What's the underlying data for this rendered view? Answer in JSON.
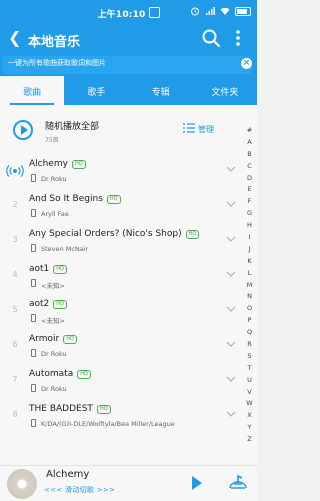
{
  "status_bar": {
    "time": "上午10:10"
  },
  "header": {
    "title": "本地音乐",
    "back_icon": "back-arrow-icon",
    "search_icon": "search-icon",
    "more_icon": "more-vertical-icon"
  },
  "banner": {
    "text": "一键为所有歌曲获取歌词和图片",
    "close_icon": "close-icon"
  },
  "tabs": [
    {
      "label": "歌曲"
    },
    {
      "label": "歌手"
    },
    {
      "label": "专辑"
    },
    {
      "label": "文件夹"
    }
  ],
  "shuffle": {
    "label": "随机播放全部",
    "count": "75首",
    "manage_label": "管理"
  },
  "songs": [
    {
      "index": "",
      "title": "Alchemy",
      "quality": "HQ",
      "artist": "Dr Roku",
      "playing": true
    },
    {
      "index": "2",
      "title": "And So It Begins",
      "quality": "HQ",
      "artist": "Aryll Fae"
    },
    {
      "index": "3",
      "title": "Any Special Orders? (Nico's Shop)",
      "quality": "HQ",
      "artist": "Steven McNair"
    },
    {
      "index": "4",
      "title": "aot1",
      "quality": "HQ",
      "artist": "<未知>"
    },
    {
      "index": "5",
      "title": "aot2",
      "quality": "HQ",
      "artist": "<未知>"
    },
    {
      "index": "6",
      "title": "Armoir",
      "quality": "HQ",
      "artist": "Dr Roku"
    },
    {
      "index": "7",
      "title": "Automata",
      "quality": "HQ",
      "artist": "Dr Roku"
    },
    {
      "index": "8",
      "title": "THE BADDEST",
      "quality": "HQ",
      "artist": "K/DA/(G)I-DLE/Wolftyla/Bea Miller/League"
    }
  ],
  "index_bar": [
    "#",
    "A",
    "B",
    "C",
    "D",
    "E",
    "F",
    "G",
    "H",
    "I",
    "J",
    "K",
    "L",
    "M",
    "N",
    "O",
    "P",
    "Q",
    "R",
    "S",
    "T",
    "U",
    "V",
    "W",
    "X",
    "Y",
    "Z"
  ],
  "player": {
    "song": "Alchemy",
    "hint": "<<< 滑动切歌 >>>"
  },
  "colors": {
    "primary": "#1f9be8",
    "hq_badge": "#4caf50"
  }
}
